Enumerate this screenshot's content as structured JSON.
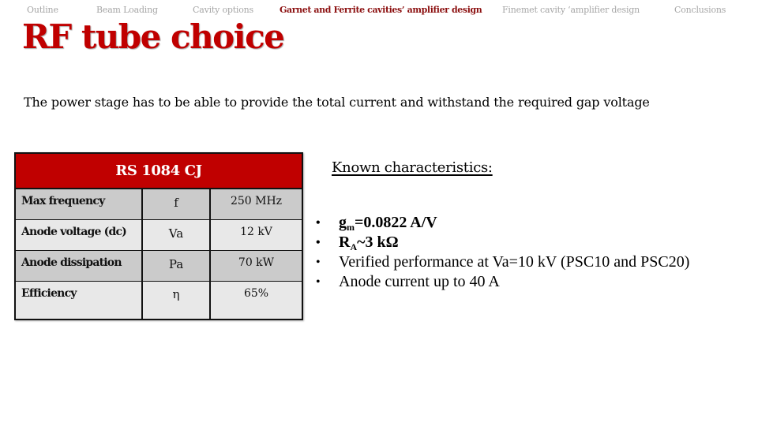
{
  "nav": {
    "items": [
      {
        "label": "Outline",
        "active": false
      },
      {
        "label": "Beam Loading",
        "active": false
      },
      {
        "label": "Cavity options",
        "active": false
      },
      {
        "label": "Garnet and Ferrite cavities’ amplifier design",
        "active": true
      },
      {
        "label": "Finemet cavity ‘amplifier design",
        "active": false
      },
      {
        "label": "Conclusions",
        "active": false
      }
    ]
  },
  "slide": {
    "title": "RF tube choice",
    "subtitle": "The power stage has to be able to provide the total current and withstand the required gap voltage"
  },
  "table": {
    "header": "RS 1084 CJ",
    "rows": [
      {
        "parameter": "Max frequency",
        "symbol": "f",
        "value": "250 MHz"
      },
      {
        "parameter": "Anode voltage (dc)",
        "symbol": "Va",
        "value": "12 kV"
      },
      {
        "parameter": "Anode dissipation",
        "symbol": "Pa",
        "value": "70 kW"
      },
      {
        "parameter": "Efficiency",
        "symbol": "η",
        "value": "65%"
      }
    ]
  },
  "characteristics": {
    "heading": "Known characteristics:",
    "bullet": "•",
    "items": [
      {
        "base": "g",
        "sub": "m",
        "rest": "=0.0822 A/V"
      },
      {
        "base": "R",
        "sub": "A",
        "rest": "~3 kΩ"
      },
      {
        "text": "Verified performance at Va=10 kV (PSC10 and PSC20)"
      },
      {
        "text": "Anode current up to 40 A"
      }
    ]
  },
  "colors": {
    "accent": "#c00000",
    "nav_active": "#8b0f0f",
    "nav_inactive": "#a6a6a6",
    "row_dark": "#cbcbcb",
    "row_light": "#e8e8e8"
  }
}
